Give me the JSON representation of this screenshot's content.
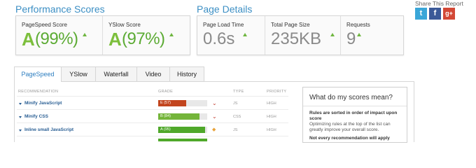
{
  "performance": {
    "title": "Performance Scores",
    "pagespeed": {
      "label": "PageSpeed Score",
      "grade": "A",
      "pct": "(99%)"
    },
    "yslow": {
      "label": "YSlow Score",
      "grade": "A",
      "pct": "(97%)"
    }
  },
  "details": {
    "title": "Page Details",
    "load_time": {
      "label": "Page Load Time",
      "value": "0.6s"
    },
    "page_size": {
      "label": "Total Page Size",
      "value": "235KB"
    },
    "requests": {
      "label": "Requests",
      "value": "9"
    }
  },
  "share": {
    "title": "Share This Report",
    "icons": [
      "twitter-icon",
      "facebook-icon",
      "google-plus-icon"
    ],
    "twitter_glyph": "t",
    "facebook_glyph": "f",
    "gplus_glyph": "g+"
  },
  "tabs": [
    {
      "label": "PageSpeed",
      "active": true
    },
    {
      "label": "YSlow",
      "active": false
    },
    {
      "label": "Waterfall",
      "active": false
    },
    {
      "label": "Video",
      "active": false
    },
    {
      "label": "History",
      "active": false
    }
  ],
  "table": {
    "headers": {
      "recommendation": "RECOMMENDATION",
      "grade": "GRADE",
      "type": "TYPE",
      "priority": "PRIORITY"
    },
    "rows": [
      {
        "name": "Minify JavaScript",
        "grade": "E (57)",
        "score": 57,
        "color": "#c2451e",
        "type": "JS",
        "priority": "HIGH",
        "trend": "down"
      },
      {
        "name": "Minify CSS",
        "grade": "B (84)",
        "score": 84,
        "color": "#74b53a",
        "type": "CSS",
        "priority": "HIGH",
        "trend": "down"
      },
      {
        "name": "Inline small JavaScript",
        "grade": "A (95)",
        "score": 95,
        "color": "#4fa82a",
        "type": "JS",
        "priority": "HIGH",
        "trend": "neutral"
      }
    ]
  },
  "scores_help": {
    "title": "What do my scores mean?",
    "p1_bold": "Rules are sorted in order of impact upon score",
    "p1": "Optimizing rules at the top of the list can greatly improve your overall score.",
    "p2_bold": "Not every recommendation will apply"
  },
  "colors": {
    "accent_blue": "#3c8fc4",
    "grade_green": "#7cbf3c",
    "trend_down": "#c0392b",
    "trend_neutral": "#e8a33a",
    "twitter": "#3aa6d8",
    "facebook": "#3b5998",
    "gplus": "#d34836"
  }
}
